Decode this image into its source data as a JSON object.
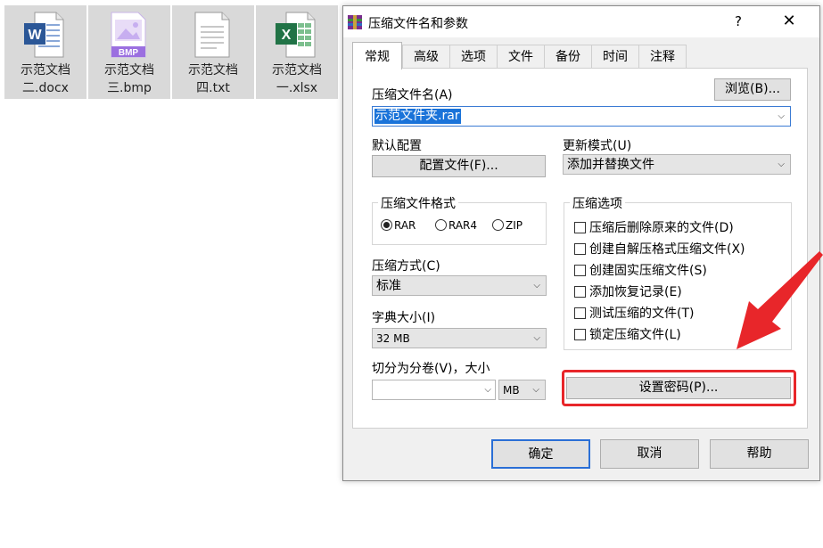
{
  "desktop_files": [
    {
      "name_line1": "示范文档",
      "name_line2": "二.docx",
      "icon": "word-document-icon"
    },
    {
      "name_line1": "示范文档",
      "name_line2": "三.bmp",
      "icon": "bmp-image-icon",
      "badge": "BMP"
    },
    {
      "name_line1": "示范文档",
      "name_line2": "四.txt",
      "icon": "text-document-icon"
    },
    {
      "name_line1": "示范文档",
      "name_line2": "一.xlsx",
      "icon": "excel-spreadsheet-icon"
    }
  ],
  "dialog": {
    "title": "压缩文件名和参数",
    "help_glyph": "?",
    "close_glyph": "✕",
    "tabs": [
      "常规",
      "高级",
      "选项",
      "文件",
      "备份",
      "时间",
      "注释"
    ],
    "active_tab": "常规",
    "archive_name_label": "压缩文件名(A)",
    "browse_button": "浏览(B)...",
    "archive_name_value": "示范文件夹.rar",
    "default_profile_label": "默认配置",
    "profile_button": "配置文件(F)...",
    "update_mode_label": "更新模式(U)",
    "update_mode_value": "添加并替换文件",
    "format_group": {
      "title": "压缩文件格式",
      "options": [
        {
          "label": "RAR",
          "selected": true
        },
        {
          "label": "RAR4",
          "selected": false
        },
        {
          "label": "ZIP",
          "selected": false
        }
      ]
    },
    "method_label": "压缩方式(C)",
    "method_value": "标准",
    "dict_label": "字典大小(I)",
    "dict_value": "32 MB",
    "split_label": "切分为分卷(V)，大小",
    "split_value": "",
    "split_unit": "MB",
    "options_group": {
      "title": "压缩选项",
      "items": [
        {
          "label": "压缩后删除原来的文件(D)",
          "checked": false
        },
        {
          "label": "创建自解压格式压缩文件(X)",
          "checked": false
        },
        {
          "label": "创建固实压缩文件(S)",
          "checked": false
        },
        {
          "label": "添加恢复记录(E)",
          "checked": false
        },
        {
          "label": "测试压缩的文件(T)",
          "checked": false
        },
        {
          "label": "锁定压缩文件(L)",
          "checked": false
        }
      ]
    },
    "password_button": "设置密码(P)...",
    "ok_button": "确定",
    "cancel_button": "取消",
    "help_button": "帮助"
  },
  "annotation": {
    "highlight_color": "#e8262a",
    "arrow_color": "#e8262a"
  }
}
